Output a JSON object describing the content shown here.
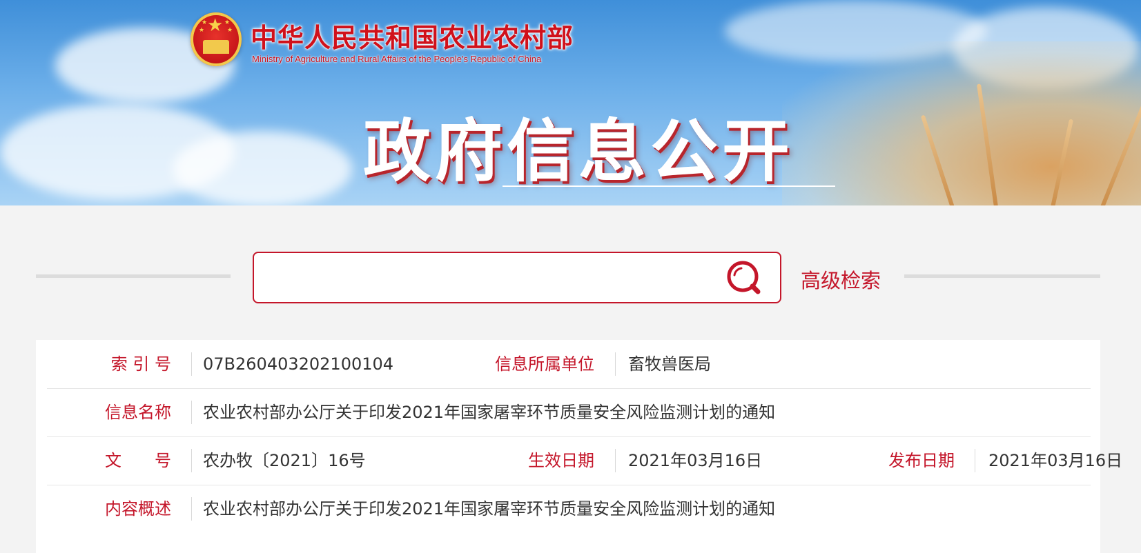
{
  "header": {
    "ministry_cn": "中华人民共和国农业农村部",
    "ministry_en": "Ministry of Agriculture and Rural Affairs of the People's Republic of China",
    "title": "政府信息公开"
  },
  "search": {
    "placeholder": "",
    "value": "",
    "advanced_label": "高级检索"
  },
  "info": {
    "index_label": "索 引 号",
    "index_value": "07B260403202100104",
    "unit_label": "信息所属单位",
    "unit_value": "畜牧兽医局",
    "name_label": "信息名称",
    "name_value": "农业农村部办公厅关于印发2021年国家屠宰环节质量安全风险监测计划的通知",
    "docno_label": "文　　号",
    "docno_value": "农办牧〔2021〕16号",
    "effective_label": "生效日期",
    "effective_value": "2021年03月16日",
    "publish_label": "发布日期",
    "publish_value": "2021年03月16日",
    "summary_label": "内容概述",
    "summary_value": "农业农村部办公厅关于印发2021年国家屠宰环节质量安全风险监测计划的通知"
  },
  "colors": {
    "accent": "#c4162a",
    "text": "#333333",
    "divider": "#e5e5e5"
  },
  "icons": {
    "search": "search-icon",
    "emblem": "national-emblem-icon"
  }
}
